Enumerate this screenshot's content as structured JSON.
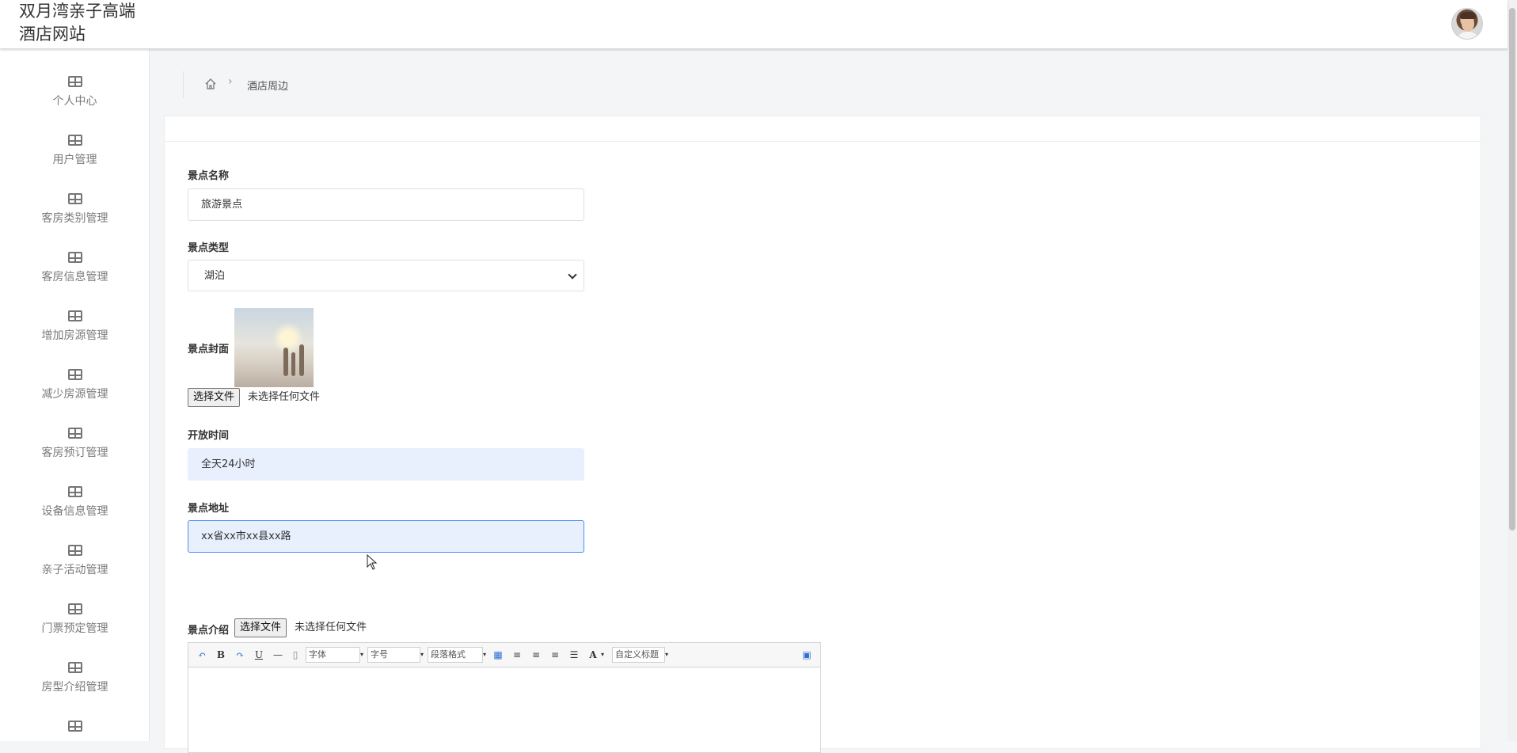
{
  "header": {
    "site_title": "双月湾亲子高端酒店网站"
  },
  "sidebar": {
    "items": [
      {
        "label": "个人中心"
      },
      {
        "label": "用户管理"
      },
      {
        "label": "客房类别管理"
      },
      {
        "label": "客房信息管理"
      },
      {
        "label": "增加房源管理"
      },
      {
        "label": "减少房源管理"
      },
      {
        "label": "客房预订管理"
      },
      {
        "label": "设备信息管理"
      },
      {
        "label": "亲子活动管理"
      },
      {
        "label": "门票预定管理"
      },
      {
        "label": "房型介绍管理"
      }
    ]
  },
  "breadcrumb": {
    "current": "酒店周边"
  },
  "form": {
    "name_label": "景点名称",
    "name_value": "旅游景点",
    "type_label": "景点类型",
    "type_value": "湖泊",
    "cover_label": "景点封面",
    "cover_file_button": "选择文件",
    "cover_file_status": "未选择任何文件",
    "hours_label": "开放时间",
    "hours_value": "全天24小时",
    "address_label": "景点地址",
    "address_value": "xx省xx市xx县xx路",
    "intro_label": "景点介绍",
    "intro_file_button": "选择文件",
    "intro_file_status": "未选择任何文件"
  },
  "editor": {
    "font_combo": "字体",
    "size_combo": "字号",
    "paragraph_combo": "段落格式",
    "custom_title_combo": "自定义标题"
  }
}
